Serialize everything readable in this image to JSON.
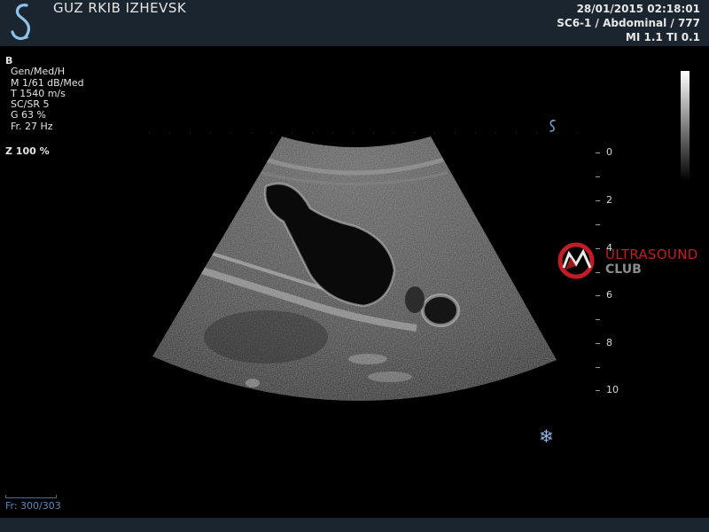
{
  "header": {
    "institution": "GUZ RKIB IZHEVSK",
    "datetime": "28/01/2015 02:18:01",
    "preset": "SC6-1 / Abdominal / 777",
    "indices": "MI 1.1  TI 0.1"
  },
  "params": {
    "mode": "B",
    "gen": "Gen/Med/H",
    "map": "M 1/61 dB/Med",
    "tissue_speed": "T 1540 m/s",
    "scsr": "SC/SR 5",
    "gain": "G 63 %",
    "frame_rate": "Fr. 27 Hz",
    "zoom": "Z  100  %"
  },
  "depth_scale": {
    "labels": [
      "0",
      "2",
      "4",
      "6",
      "8",
      "10"
    ]
  },
  "watermark": {
    "line1": "ULTRASOUND",
    "line2": "CLUB",
    "color": "#c41b25"
  },
  "cine": {
    "label": "Fr: 300/303"
  },
  "icons": {
    "logo": "s-logo-icon",
    "probe_orientation": "s-marker-icon",
    "freeze": "snowflake-icon"
  },
  "colors": {
    "header_bg": "#1b2530",
    "accent": "#8fb7e6"
  }
}
